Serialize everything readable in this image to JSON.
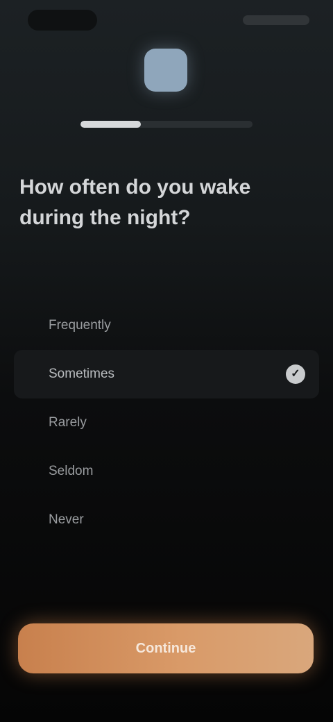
{
  "header": {
    "progress": 0.35
  },
  "question": {
    "text": "How often do you wake during the night?"
  },
  "options": [
    {
      "label": "Frequently",
      "selected": false
    },
    {
      "label": "Sometimes",
      "selected": true
    },
    {
      "label": "Rarely",
      "selected": false
    },
    {
      "label": "Seldom",
      "selected": false
    },
    {
      "label": "Never",
      "selected": false
    }
  ],
  "cta": {
    "label": "Continue"
  }
}
